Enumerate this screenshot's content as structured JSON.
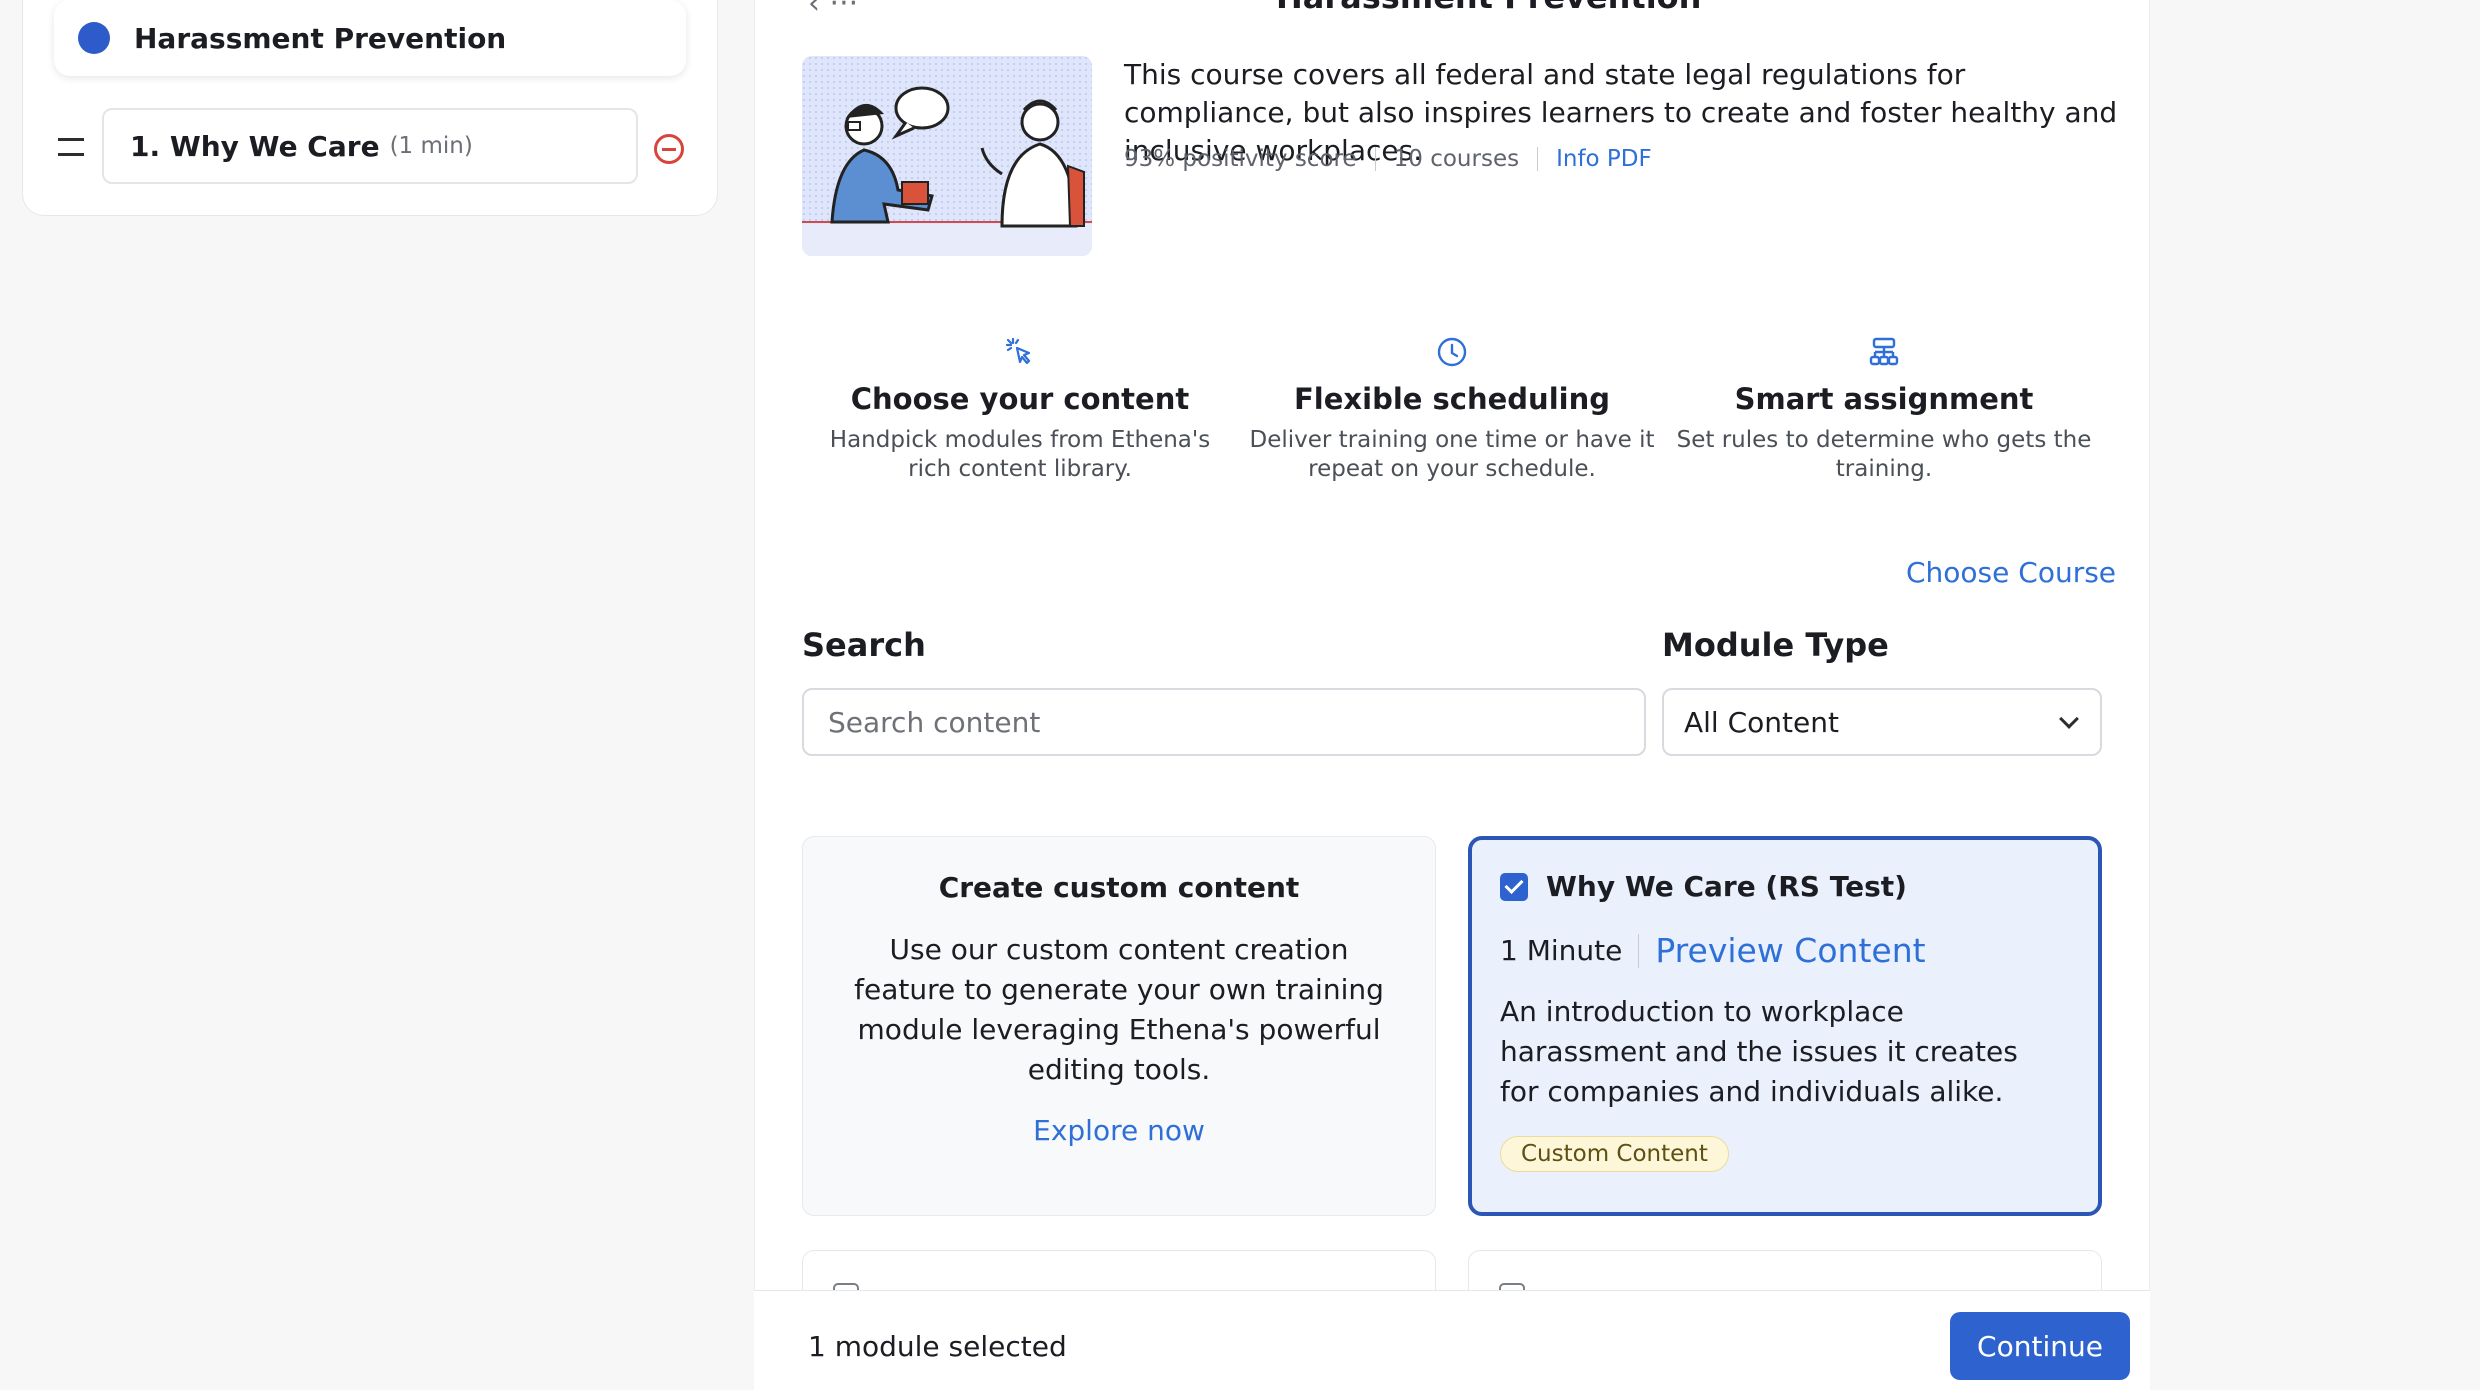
{
  "sidebar": {
    "course_title": "Harassment Prevention",
    "module": {
      "title": "1. Why We Care",
      "duration": "(1 min)"
    }
  },
  "header": {
    "title": "Harassment Prevention"
  },
  "course": {
    "description": "This course covers all federal and state legal regulations for compliance, but also inspires learners to create and foster healthy and inclusive workplaces.",
    "positivity": "93% positivity score",
    "courses_count": "10 courses",
    "info_link": "Info PDF"
  },
  "features": [
    {
      "title": "Choose your content",
      "desc": "Handpick modules from Ethena's rich content library.",
      "icon": "cursor-click-icon"
    },
    {
      "title": "Flexible scheduling",
      "desc": "Deliver training one time or have it repeat on your schedule.",
      "icon": "clock-icon"
    },
    {
      "title": "Smart assignment",
      "desc": "Set rules to determine who gets the training.",
      "icon": "hierarchy-icon"
    }
  ],
  "choose_course_link": "Choose Course",
  "search": {
    "label": "Search",
    "placeholder": "Search content"
  },
  "module_type": {
    "label": "Module Type",
    "selected": "All Content"
  },
  "custom_card": {
    "title": "Create custom content",
    "desc": "Use our custom content creation feature to generate your own training module leveraging Ethena's powerful editing tools.",
    "link": "Explore now"
  },
  "selected_card": {
    "title": "Why We Care (RS Test)",
    "duration": "1 Minute",
    "preview": "Preview Content",
    "desc": "An introduction to workplace harassment and the issues it creates for companies and individuals alike.",
    "badge": "Custom Content",
    "checked": true
  },
  "footer": {
    "selected_text": "1 module selected",
    "continue_label": "Continue"
  },
  "colors": {
    "accent": "#2e63cf",
    "link": "#2e6fd8",
    "selected_border": "#2b56b5",
    "danger": "#d9433c"
  }
}
